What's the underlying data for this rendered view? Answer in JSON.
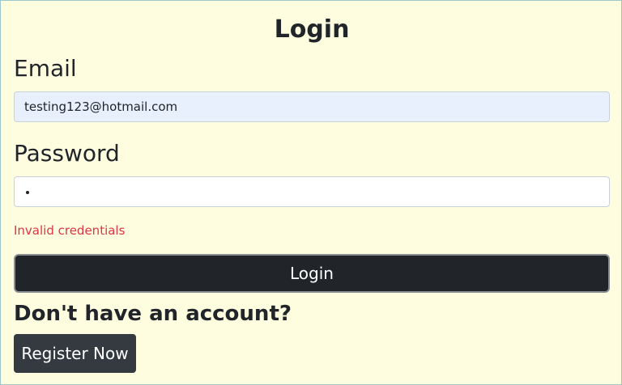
{
  "page": {
    "title": "Login"
  },
  "form": {
    "email_label": "Email",
    "email_value": "testing123@hotmail.com",
    "password_label": "Password",
    "password_masked": "•",
    "error_text": "Invalid credentials",
    "login_button_label": "Login"
  },
  "signup": {
    "prompt": "Don't have an account?",
    "register_button_label": "Register Now"
  }
}
